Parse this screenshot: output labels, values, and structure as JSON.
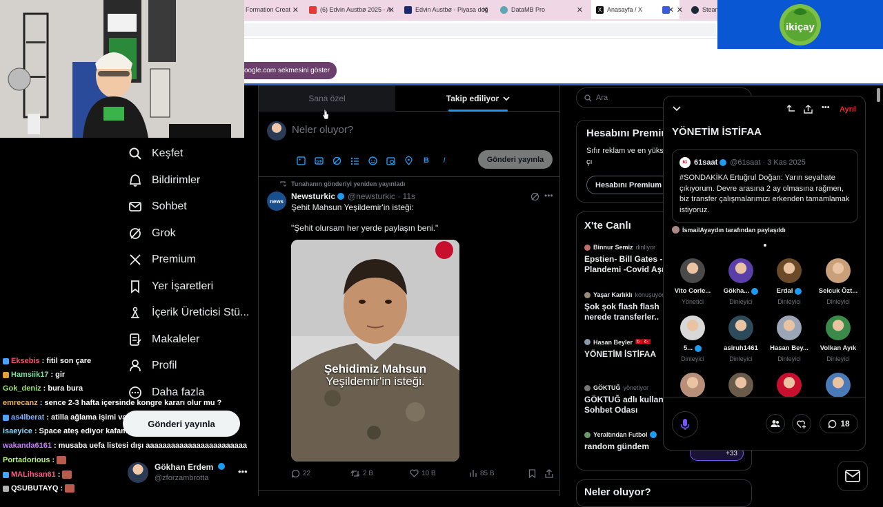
{
  "colors": {
    "accent": "#1d9bf0",
    "leave": "#f4212e",
    "spaces": "#7856ff",
    "brand_bg": "#0a57d3",
    "tabbar_bg": "#f0d7e6"
  },
  "browser": {
    "tabs": [
      {
        "label": "Formation Creat",
        "icon": "page-icon",
        "color": "#888"
      },
      {
        "label": "(6) Edvin Austbø 2025 - A",
        "icon": "youtube-icon",
        "color": "#e53935"
      },
      {
        "label": "Edvin Austbø - Piyasa değ",
        "icon": "transfermarkt-icon",
        "color": "#1a2b6d"
      },
      {
        "label": "DataMB Pro",
        "icon": "datamb-icon",
        "color": "#5ca5b5"
      },
      {
        "label": "Anasayfa / X",
        "icon": "x-icon",
        "color": "#111"
      },
      {
        "label": "",
        "icon": "window-icon",
        "color": "#3b5bdb"
      },
      {
        "label": "Steam",
        "icon": "steam-icon",
        "color": "#1b2838"
      }
    ],
    "tooltip": "oogle.com sekmesini göster",
    "brand_text": "ikiçay"
  },
  "sidebar": {
    "items": [
      {
        "label": "Keşfet",
        "icon": "search-icon"
      },
      {
        "label": "Bildirimler",
        "icon": "bell-icon"
      },
      {
        "label": "Sohbet",
        "icon": "mail-icon"
      },
      {
        "label": "Grok",
        "icon": "grok-icon"
      },
      {
        "label": "Premium",
        "icon": "x-logo-icon"
      },
      {
        "label": "Yer İşaretleri",
        "icon": "bookmark-icon"
      },
      {
        "label": "İçerik Üreticisi Stü...",
        "icon": "creator-studio-icon"
      },
      {
        "label": "Makaleler",
        "icon": "articles-icon"
      },
      {
        "label": "Profil",
        "icon": "profile-icon"
      },
      {
        "label": "Daha fazla",
        "icon": "more-circle-icon"
      }
    ],
    "post_button": "Gönderi yayınla",
    "profile": {
      "name": "Gökhan Erdem",
      "handle": "@zforzambrotta",
      "more": "•••"
    }
  },
  "chat": [
    {
      "user": "Eksebis",
      "msg": ": fitil son çare",
      "color": "#ff4d6d",
      "badge": "#4aa3ff"
    },
    {
      "user": "Hamsiik17",
      "msg": ": gir",
      "color": "#7ee0a0",
      "badge": "#e0a040"
    },
    {
      "user": "Gok_deniz",
      "msg": ": bura bura",
      "color": "#9be36b",
      "badge": ""
    },
    {
      "user": "emrecanz",
      "msg": ": sence 2-3 hafta içersinde kongre kararı olur mu ?",
      "color": "#f0b060",
      "badge": ""
    },
    {
      "user": "as4lberat",
      "msg": ": atilla ağlama işimi var",
      "color": "#7fb3ff",
      "badge": "#4aa3ff"
    },
    {
      "user": "isaeyice",
      "msg": ": Space ateş ediyor kafam yandı kaçtım",
      "color": "#8fd7ff",
      "badge": ""
    },
    {
      "user": "wakanda6161",
      "msg": ": musaba uefa listesi dışı aaaaaaaaaaaaaaaaaaaaaaaa",
      "color": "#c77dff",
      "badge": ""
    },
    {
      "user": "Portadorious",
      "msg": ":",
      "color": "#b6f07a",
      "badge": "",
      "emote": true
    },
    {
      "user": "MALihsan61",
      "msg": ":",
      "color": "#ff5c8a",
      "badge": "#4aa3ff",
      "emote": true
    },
    {
      "user": "QSUBUTAYQ",
      "msg": ":",
      "color": "#ffffff",
      "badge": "#b0b0b0",
      "emote": true
    }
  ],
  "main": {
    "tabs": {
      "for_you": "Sana özel",
      "following": "Takip ediliyor"
    },
    "composer": {
      "placeholder": "Neler oluyor?",
      "post_button": "Gönderi yayınla",
      "tools": [
        "image-icon",
        "gif-icon",
        "grok-icon",
        "poll-icon",
        "emoji-icon",
        "schedule-icon",
        "location-icon",
        "bold-icon",
        "italic-icon"
      ]
    },
    "tweet": {
      "retweet_context": "Tunahanın gönderiyi yeniden yayınladı",
      "avatar_text": "news",
      "name": "Newsturkic",
      "handle": "@newsturkic · 11s",
      "line1": "Şehit Mahsun Yeşildemir'in isteği:",
      "line2": "\"Şehit olursam her yerde paylaşın beni.\"",
      "media_title_1": "Şehidimiz Mahsun",
      "media_title_2": "Yeşildemir'in isteği.",
      "replies": "22",
      "reposts": "2 B",
      "likes": "10 B",
      "views": "85 B"
    }
  },
  "right": {
    "search_placeholder": "Ara",
    "premium": {
      "title": "Hesabını Premiu",
      "desc": "Sıfır reklam ve en yüks avantajlarının tadını çı",
      "button": "Hesabını Premium"
    },
    "live": {
      "title": "X'te Canlı",
      "items": [
        {
          "host": "Binnur Semiz",
          "role": "dinliyor",
          "text1": "Epstien- Bill Gates -",
          "text2": "Plandemi -Covid Aşıla"
        },
        {
          "host": "Yaşar Karlıklı",
          "role": "konuşuyor",
          "text1": "Şok şok flash flash",
          "text2": "nerede transferler.."
        },
        {
          "host": "Hasan Beyler",
          "role": "",
          "text1": "YÖNETİM İSTİFAA",
          "text2": ""
        },
        {
          "host": "GÖKTUĞ",
          "role": "yönetiyor",
          "text1": "GÖKTUĞ adlı kullanıc",
          "text2": "Sohbet Odası"
        },
        {
          "host": "Yeraltından Futbol",
          "role": "",
          "text1": "random gündem",
          "text2": ""
        }
      ],
      "more_count": "+33"
    },
    "neler": "Neler oluyor?"
  },
  "space": {
    "leave": "Ayrıl",
    "title": "YÖNETİM İSTİFAA",
    "quote": {
      "avatar_text": "61",
      "name": "61saat",
      "meta": "@61saat · 3 Kas 2025",
      "text": "#SONDAKİKA Ertuğrul Doğan: Yarın seyahate çıkıyorum. Devre arasına 2 ay olmasına rağmen, biz transfer çalışmalarımızı erkenden tamamlamak istiyoruz."
    },
    "shared_by": "İsmailAyaydın tarafından paylaşıldı",
    "speakers": [
      {
        "name": "Vito Corle...",
        "role": "Yönetici",
        "verified": false,
        "color": "#4a4a4a"
      },
      {
        "name": "Gökha...",
        "role": "Dinleyici",
        "verified": true,
        "color": "#5b3fa8"
      },
      {
        "name": "Erdal",
        "role": "Dinleyici",
        "verified": true,
        "color": "#6b4a2a"
      },
      {
        "name": "Selcuk Özt...",
        "role": "Dinleyici",
        "verified": false,
        "color": "#c9a07a"
      },
      {
        "name": "5...",
        "role": "Dinleyici",
        "verified": true,
        "color": "#d8d8d8"
      },
      {
        "name": "asiruh1461",
        "role": "Dinleyici",
        "verified": false,
        "color": "#2c4a5a"
      },
      {
        "name": "Hasan Bey...",
        "role": "Dinleyici",
        "verified": false,
        "color": "#9aa5b5"
      },
      {
        "name": "Volkan Ayık",
        "role": "Dinleyici",
        "verified": false,
        "color": "#3a8a4a"
      },
      {
        "name": "",
        "role": "",
        "verified": false,
        "color": "#b8907a"
      },
      {
        "name": "",
        "role": "",
        "verified": false,
        "color": "#6a5a4a"
      },
      {
        "name": "",
        "role": "",
        "verified": false,
        "color": "#c8102e"
      },
      {
        "name": "",
        "role": "",
        "verified": false,
        "color": "#4a7ab8"
      }
    ],
    "comments": "18"
  }
}
